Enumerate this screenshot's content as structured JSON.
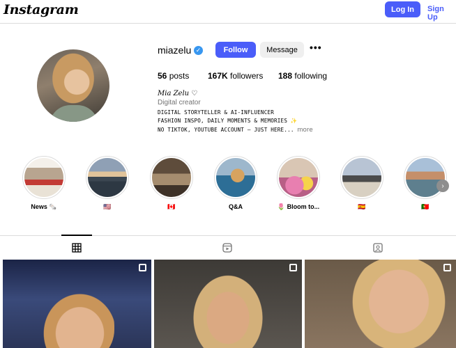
{
  "header": {
    "logo_text": "Instagram",
    "login_label": "Log In",
    "signup_label": "Sign Up"
  },
  "profile": {
    "username": "miazelu",
    "verified_mark": "✓",
    "follow_label": "Follow",
    "message_label": "Message",
    "more_label": "•••",
    "stats": {
      "posts_count": "56",
      "posts_label": "posts",
      "followers_count": "167K",
      "followers_label": "followers",
      "following_count": "188",
      "following_label": "following"
    },
    "full_name": "Mia Zelu ♡",
    "category": "Digital creator",
    "bio_lines": [
      "DIGITAL STORYTELLER & AI-INFLUENCER",
      "FASHION INSPO, DAILY MOMENTS & MEMORIES ✨",
      "NO TIKTOK, YOUTUBE ACCOUNT – JUST HERE..."
    ],
    "bio_more": "more"
  },
  "highlights": [
    {
      "label": "News 🗞️"
    },
    {
      "label": "🇺🇸"
    },
    {
      "label": "🇨🇦"
    },
    {
      "label": "Q&A"
    },
    {
      "label": "🌷 Bloom to..."
    },
    {
      "label": "🇪🇸"
    },
    {
      "label": "🇵🇹"
    }
  ],
  "highlights_next_icon": "›",
  "tabs": [
    "posts-grid-tab",
    "reels-tab",
    "tagged-tab"
  ],
  "colors": {
    "accent": "#4a5df9",
    "verified": "#3897f0",
    "secondary_text": "#737373",
    "border": "#dbdbdb"
  }
}
